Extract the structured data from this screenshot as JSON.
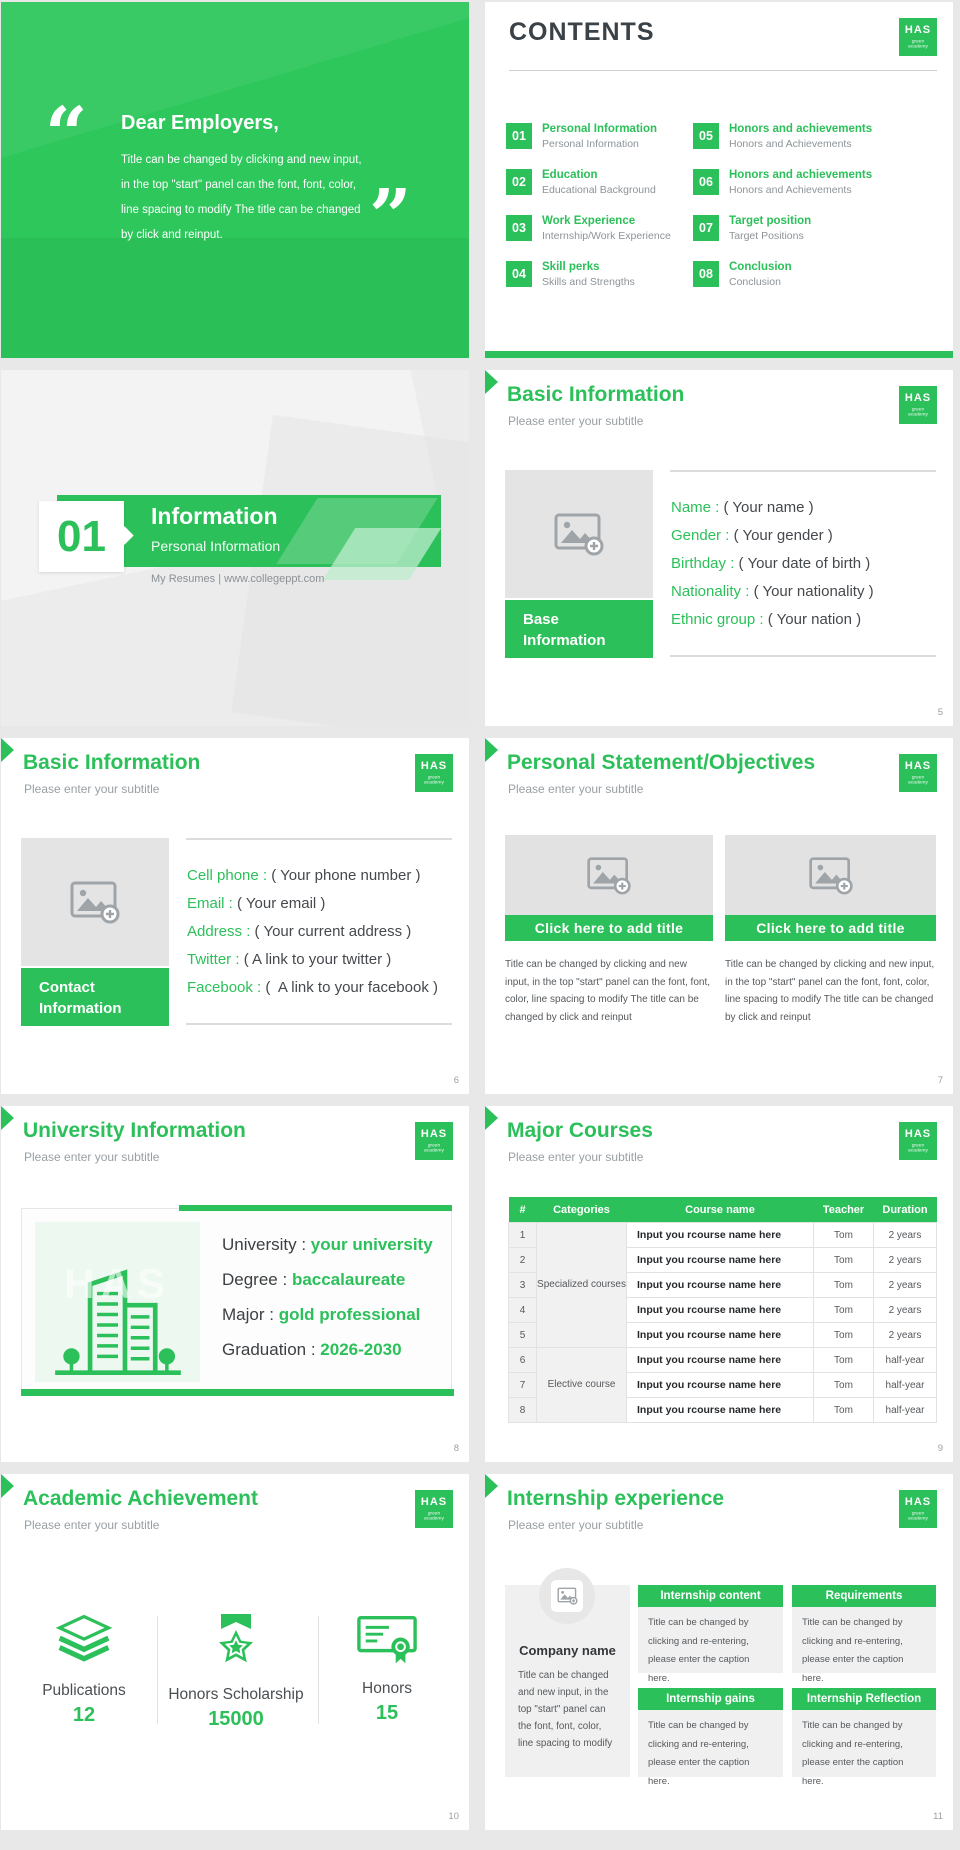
{
  "colors": {
    "green": "#2cc05a",
    "cover_green": "#2dc75c",
    "dark": "#3a4147",
    "subtitle_gray": "#98a0a4",
    "body_gray": "#55595d",
    "panel_green": "#edf8f0",
    "card_gray": "#f0f0f0"
  },
  "sep": " : ",
  "logo": {
    "text": "HAS",
    "sub": "green academy"
  },
  "icons": {
    "logo": "has-badge",
    "image_placeholder": "image-with-plus",
    "chevron": "right-triangle",
    "publications": "stacked-papers",
    "scholarship": "medal-with-star",
    "honors": "certificate-rosette",
    "building": "university-building",
    "quote_open": "“",
    "quote_close": "”"
  },
  "cover": {
    "quote_open": "“",
    "quote_close": "”",
    "title": "Dear Employers,",
    "body": "Title can be changed by clicking and new input, in the top \"start\" panel can the font, font, color, line spacing to modify The title can be changed by click and reinput."
  },
  "contents": {
    "title": "CONTENTS",
    "items": [
      {
        "num": "01",
        "title": "Personal Information",
        "sub": "Personal Information"
      },
      {
        "num": "02",
        "title": "Education",
        "sub": "Educational Background"
      },
      {
        "num": "03",
        "title": "Work Experience",
        "sub": "Internship/Work Experience"
      },
      {
        "num": "04",
        "title": "Skill perks",
        "sub": "Skills and Strengths"
      },
      {
        "num": "05",
        "title": "Honors and achievements",
        "sub": "Honors and Achievements"
      },
      {
        "num": "06",
        "title": "Honors and achievements",
        "sub": "Honors and Achievements"
      },
      {
        "num": "07",
        "title": "Target position",
        "sub": "Target Positions"
      },
      {
        "num": "08",
        "title": "Conclusion",
        "sub": "Conclusion"
      }
    ]
  },
  "section": {
    "num": "01",
    "title": "Information",
    "sub": "Personal Information",
    "footer": "My Resumes | www.collegeppt.com"
  },
  "base_info": {
    "title": "Basic Information",
    "sub": "Please enter your subtitle",
    "box_line1": "Base",
    "box_line2": "Information",
    "fields": [
      {
        "label": "Name",
        "value": "( Your name )"
      },
      {
        "label": "Gender",
        "value": "( Your gender )"
      },
      {
        "label": "Birthday",
        "value": "( Your date of birth )"
      },
      {
        "label": "Nationality",
        "value": "( Your nationality )"
      },
      {
        "label": "Ethnic group",
        "value": "( Your nation )"
      }
    ],
    "page": "5"
  },
  "contact_info": {
    "title": "Basic Information",
    "sub": "Please enter your subtitle",
    "box_line1": "Contact",
    "box_line2": "Information",
    "fields": [
      {
        "label": "Cell phone",
        "value": "( Your phone number )"
      },
      {
        "label": "Email",
        "value": "( Your email )"
      },
      {
        "label": "Address",
        "value": "( Your current address )"
      },
      {
        "label": "Twitter",
        "value": "( A link to your twitter )"
      },
      {
        "label": "Facebook",
        "value": "(  A link to your facebook )"
      }
    ],
    "page": "6"
  },
  "statement": {
    "title": "Personal Statement/Objectives",
    "sub": "Please enter your subtitle",
    "card_title": "Click here to add title",
    "body_left": "Title can be changed by clicking and new input, in the top \"start\" panel can the font, font, color, line spacing to modify The title can be changed by click and reinput",
    "body_right": "Title can be changed by clicking and new input, in the top \"start\" panel can the font, font, color, line spacing to modify The title can be changed by click and reinput",
    "page": "7"
  },
  "university": {
    "title": "University Information",
    "sub": "Please enter your subtitle",
    "watermark": "HAS",
    "fields": [
      {
        "label": "University",
        "value": "your university"
      },
      {
        "label": "Degree",
        "value": "baccalaureate"
      },
      {
        "label": "Major",
        "value": "gold professional"
      },
      {
        "label": "Graduation",
        "value": "2026-2030"
      }
    ],
    "page": "8"
  },
  "courses": {
    "title": "Major Courses",
    "sub": "Please enter your subtitle",
    "headers": [
      "#",
      "Categories",
      "Course name",
      "Teacher",
      "Duration"
    ],
    "groups": [
      {
        "label": "Specialized courses",
        "rows": 5
      },
      {
        "label": "Elective course",
        "rows": 3
      }
    ],
    "rows": [
      {
        "num": "1",
        "course": "Input you rcourse name here",
        "teacher": "Tom",
        "duration": "2 years"
      },
      {
        "num": "2",
        "course": "Input you rcourse name here",
        "teacher": "Tom",
        "duration": "2 years"
      },
      {
        "num": "3",
        "course": "Input you rcourse name here",
        "teacher": "Tom",
        "duration": "2 years"
      },
      {
        "num": "4",
        "course": "Input you rcourse name here",
        "teacher": "Tom",
        "duration": "2 years"
      },
      {
        "num": "5",
        "course": "Input you rcourse name here",
        "teacher": "Tom",
        "duration": "2 years"
      },
      {
        "num": "6",
        "course": "Input you rcourse name here",
        "teacher": "Tom",
        "duration": "half-year"
      },
      {
        "num": "7",
        "course": "Input you rcourse name here",
        "teacher": "Tom",
        "duration": "half-year"
      },
      {
        "num": "8",
        "course": "Input you rcourse name here",
        "teacher": "Tom",
        "duration": "half-year"
      }
    ],
    "page": "9"
  },
  "achievement": {
    "title": "Academic Achievement",
    "sub": "Please enter your subtitle",
    "items": [
      {
        "icon": "publications-icon",
        "label": "Publications",
        "value": "12"
      },
      {
        "icon": "scholarship-medal-icon",
        "label": "Honors Scholarship",
        "value": "15000"
      },
      {
        "icon": "honors-certificate-icon",
        "label": "Honors",
        "value": "15"
      }
    ],
    "page": "10"
  },
  "internship": {
    "title": "Internship experience",
    "sub": "Please enter your subtitle",
    "company_name": "Company name",
    "company_body": "Title can be changed and new input, in the top \"start\" panel can the font, font, color, line spacing to modify",
    "cards": [
      {
        "title": "Internship content",
        "body": "Title can be changed by clicking and re-entering, please enter the caption here."
      },
      {
        "title": "Requirements",
        "body": "Title can be changed by clicking and re-entering, please enter the caption here."
      },
      {
        "title": "Internship gains",
        "body": "Title can be changed by clicking and re-entering, please enter the caption here."
      },
      {
        "title": "Internship Reflection",
        "body": "Title can be changed by clicking and re-entering, please enter the caption here."
      }
    ],
    "page": "11"
  }
}
